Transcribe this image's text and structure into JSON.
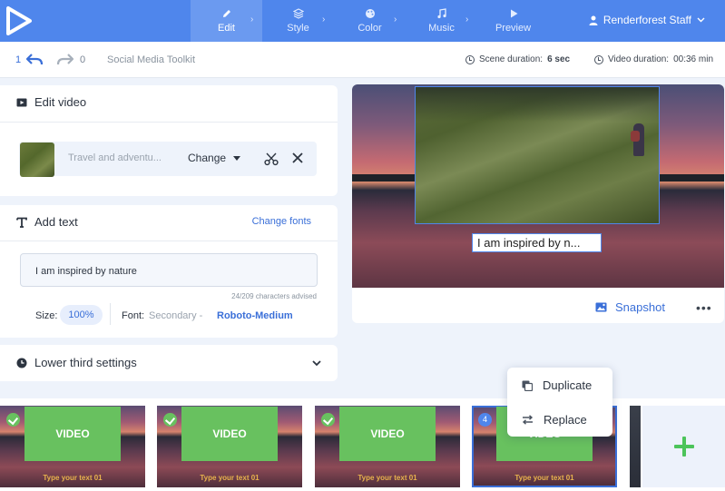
{
  "nav": {
    "steps": [
      {
        "label": "Edit",
        "active": true,
        "icon": "pencil-icon"
      },
      {
        "label": "Style",
        "active": false,
        "icon": "layers-icon"
      },
      {
        "label": "Color",
        "active": false,
        "icon": "palette-icon"
      },
      {
        "label": "Music",
        "active": false,
        "icon": "music-note-icon"
      },
      {
        "label": "Preview",
        "active": false,
        "icon": "play-icon"
      }
    ],
    "user": "Renderforest Staff"
  },
  "toolbar": {
    "undo_count": "1",
    "redo_count": "0",
    "project_name": "Social Media Toolkit",
    "scene_duration_label": "Scene duration:",
    "scene_duration_value": "6 sec",
    "video_duration_label": "Video duration:",
    "video_duration_value": "00:36 min"
  },
  "edit_video": {
    "title": "Edit video",
    "media_name": "Travel and adventu...",
    "change_label": "Change"
  },
  "add_text": {
    "title": "Add text",
    "change_fonts_label": "Change fonts",
    "text_value": "I am inspired by nature",
    "chars_advised": "24/209 characters advised",
    "size_label": "Size:",
    "size_value": "100%",
    "font_label": "Font:",
    "font_type": "Secondary -",
    "font_name": "Roboto-Medium"
  },
  "lower_third": {
    "title": "Lower third settings"
  },
  "preview": {
    "caption": "I am inspired by n...",
    "snapshot_label": "Snapshot",
    "more_label": "•••"
  },
  "timeline": {
    "clips": [
      {
        "label": "VIDEO",
        "text": "Type your text 01",
        "badge": "check"
      },
      {
        "label": "VIDEO",
        "text": "Type your text 01",
        "badge": "check"
      },
      {
        "label": "VIDEO",
        "text": "Type your text 01",
        "badge": "check"
      },
      {
        "label": "VIDEO",
        "text": "Type your text 01",
        "badge": "4"
      }
    ]
  },
  "context_menu": {
    "duplicate_label": "Duplicate",
    "replace_label": "Replace"
  },
  "colors": {
    "brand_blue": "#4f86ec",
    "link_blue": "#3a6fd8",
    "accent_green": "#68c15f"
  }
}
